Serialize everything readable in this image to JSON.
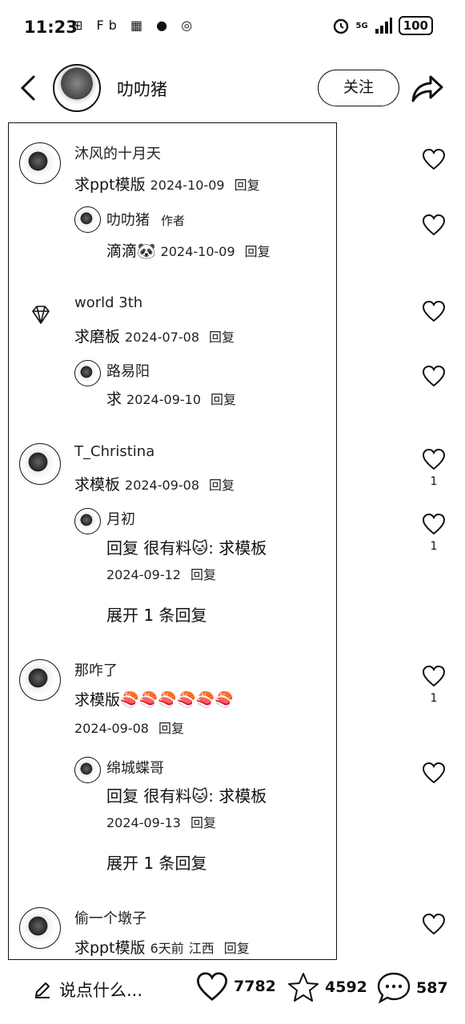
{
  "status": {
    "time": "11:23",
    "left_icons": "⊞ Fb ▦ ● ◎",
    "network": "5G",
    "battery": "100"
  },
  "header": {
    "author_name": "叻叻猪",
    "follow_label": "关注"
  },
  "comments": [
    {
      "name": "沐风的十月天",
      "text": "求ppt模版",
      "date": "2024-10-09",
      "reply_label": "回复",
      "replies": [
        {
          "name": "叻叻猪",
          "tag": "作者",
          "text": "滴滴🐼",
          "date": "2024-10-09",
          "reply_label": "回复"
        }
      ]
    },
    {
      "name": "world 3th",
      "text": "求磨板",
      "date": "2024-07-08",
      "reply_label": "回复",
      "replies": [
        {
          "name": "路易阳",
          "text": "求",
          "date": "2024-09-10",
          "reply_label": "回复"
        }
      ]
    },
    {
      "name": "T_Christina",
      "text": "求模板",
      "date": "2024-09-08",
      "reply_label": "回复",
      "likes": "1",
      "replies": [
        {
          "name": "月初",
          "text": "回复 很有料🐱: 求模板",
          "date": "2024-09-12",
          "reply_label": "回复",
          "likes": "1"
        }
      ],
      "expand": "展开 1 条回复"
    },
    {
      "name": "那咋了",
      "text": "求模版🍣🍣🍣🍣🍣🍣",
      "date": "2024-09-08",
      "reply_label": "回复",
      "likes": "1",
      "replies": [
        {
          "name": "绵城蝶哥",
          "text": "回复 很有料🐱: 求模板",
          "date": "2024-09-13",
          "reply_label": "回复"
        }
      ],
      "expand": "展开 1 条回复"
    },
    {
      "name": "偷一个墩子",
      "text": "求ppt模版",
      "date": "6天前",
      "location": "江西",
      "reply_label": "回复"
    }
  ],
  "bottom": {
    "input_placeholder": "说点什么...",
    "likes": "7782",
    "favorites": "4592",
    "comments": "587"
  },
  "icons": {
    "back": "chevron-left-icon",
    "share": "share-arrow-icon",
    "like": "heart-icon",
    "favorite": "star-icon",
    "comment": "chat-bubble-icon",
    "edit": "pencil-icon",
    "diamond": "diamond-icon"
  }
}
